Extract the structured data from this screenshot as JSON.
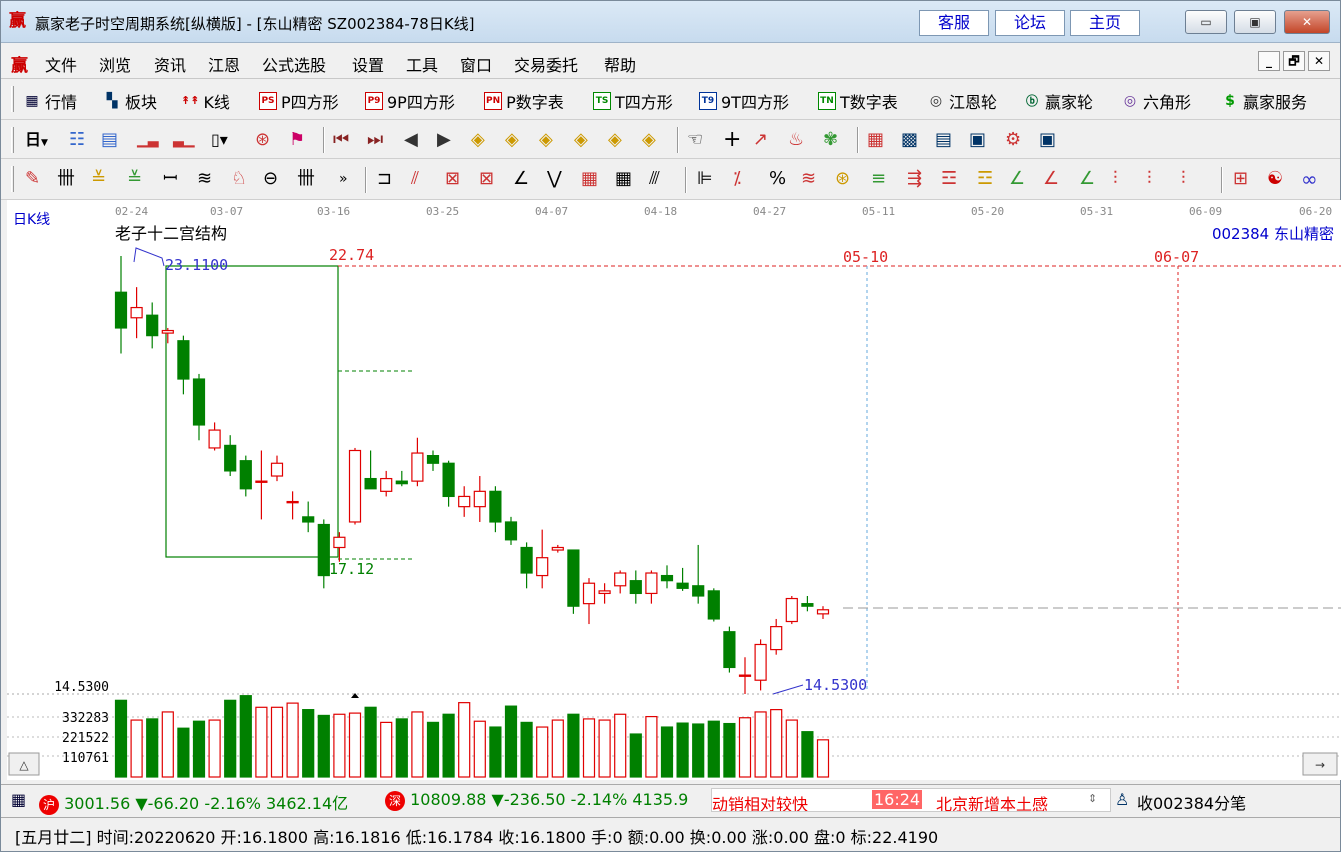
{
  "titlebar": {
    "app_icon": "赢",
    "title": "赢家老子时空周期系统[纵横版] - [东山精密  SZ002384-78日K线]",
    "links": [
      "客服",
      "论坛",
      "主页"
    ],
    "window_buttons": [
      "minimize",
      "maximize",
      "close"
    ]
  },
  "menubar": {
    "logo": "赢",
    "items": [
      "文件",
      "浏览",
      "资讯",
      "江恩",
      "公式选股",
      "设置",
      "工具",
      "窗口",
      "交易委托",
      "帮助"
    ],
    "mdi_buttons": [
      "_",
      "🗗",
      "✕"
    ]
  },
  "toolbar1": {
    "items": [
      {
        "icon": "table-icon",
        "label": "行情"
      },
      {
        "icon": "blocks-icon",
        "label": "板块"
      },
      {
        "icon": "kline-icon",
        "label": "K线"
      },
      {
        "icon": "PS",
        "label": "P四方形"
      },
      {
        "icon": "P9",
        "label": "9P四方形"
      },
      {
        "icon": "PN",
        "label": "P数字表"
      },
      {
        "icon": "TS",
        "label": "T四方形"
      },
      {
        "icon": "T9",
        "label": "9T四方形"
      },
      {
        "icon": "TN",
        "label": "T数字表"
      },
      {
        "icon": "wheel-icon",
        "label": "江恩轮"
      },
      {
        "icon": "big-wheel-icon",
        "label": "赢家轮"
      },
      {
        "icon": "hexagon-icon",
        "label": "六角形"
      },
      {
        "icon": "dollar-icon",
        "label": "赢家服务"
      }
    ]
  },
  "toolbar2": {
    "period": "日"
  },
  "chart": {
    "period_label": "日K线",
    "indicator_title": "老子十二宫结构",
    "stock_code_name": "002384  东山精密",
    "date_ticks": [
      "02-24",
      "03-07",
      "03-16",
      "03-25",
      "04-07",
      "04-18",
      "04-27",
      "05-11",
      "05-20",
      "05-31",
      "06-09",
      "06-20"
    ],
    "labels": {
      "high": "23.1100",
      "box_top": "22.74",
      "box_bottom": "17.12",
      "low": "14.5300",
      "date_a": "05-10",
      "date_b": "06-07"
    },
    "price_axis_low": "14.5300",
    "volume_axis": [
      "332283",
      "221522",
      "110761"
    ],
    "colors": {
      "up": "#e00000",
      "down": "#008000",
      "box": "#008000",
      "label_blue": "#3333cc",
      "label_red": "#dd2222"
    },
    "candles": [
      {
        "o": 22.4,
        "h": 23.11,
        "l": 21.2,
        "c": 21.7
      },
      {
        "o": 21.9,
        "h": 22.5,
        "l": 21.5,
        "c": 22.1
      },
      {
        "o": 21.95,
        "h": 22.2,
        "l": 21.3,
        "c": 21.55
      },
      {
        "o": 21.6,
        "h": 21.7,
        "l": 21.4,
        "c": 21.65
      },
      {
        "o": 21.45,
        "h": 21.55,
        "l": 20.4,
        "c": 20.7
      },
      {
        "o": 20.7,
        "h": 20.8,
        "l": 19.5,
        "c": 19.8
      },
      {
        "o": 19.35,
        "h": 19.85,
        "l": 19.3,
        "c": 19.7
      },
      {
        "o": 19.4,
        "h": 19.6,
        "l": 18.8,
        "c": 18.9
      },
      {
        "o": 19.1,
        "h": 19.2,
        "l": 18.4,
        "c": 18.55
      },
      {
        "o": 18.7,
        "h": 19.3,
        "l": 17.95,
        "c": 18.7
      },
      {
        "o": 18.8,
        "h": 19.2,
        "l": 18.7,
        "c": 19.05
      },
      {
        "o": 18.3,
        "h": 18.5,
        "l": 17.95,
        "c": 18.3
      },
      {
        "o": 18.0,
        "h": 18.3,
        "l": 17.7,
        "c": 17.9
      },
      {
        "o": 17.85,
        "h": 17.95,
        "l": 16.6,
        "c": 16.85
      },
      {
        "o": 17.4,
        "h": 17.7,
        "l": 17.12,
        "c": 17.6
      },
      {
        "o": 17.9,
        "h": 19.35,
        "l": 17.85,
        "c": 19.3
      },
      {
        "o": 18.75,
        "h": 19.3,
        "l": 18.6,
        "c": 18.55
      },
      {
        "o": 18.5,
        "h": 18.9,
        "l": 18.4,
        "c": 18.75
      },
      {
        "o": 18.7,
        "h": 18.9,
        "l": 18.6,
        "c": 18.65
      },
      {
        "o": 18.7,
        "h": 19.55,
        "l": 18.6,
        "c": 19.25
      },
      {
        "o": 19.2,
        "h": 19.3,
        "l": 18.9,
        "c": 19.05
      },
      {
        "o": 19.05,
        "h": 19.1,
        "l": 18.2,
        "c": 18.4
      },
      {
        "o": 18.2,
        "h": 18.6,
        "l": 18.0,
        "c": 18.4
      },
      {
        "o": 18.2,
        "h": 18.8,
        "l": 17.9,
        "c": 18.5
      },
      {
        "o": 18.5,
        "h": 18.6,
        "l": 17.7,
        "c": 17.9
      },
      {
        "o": 17.9,
        "h": 18.0,
        "l": 17.45,
        "c": 17.55
      },
      {
        "o": 17.4,
        "h": 17.5,
        "l": 16.6,
        "c": 16.9
      },
      {
        "o": 16.85,
        "h": 17.75,
        "l": 16.6,
        "c": 17.2
      },
      {
        "o": 17.35,
        "h": 17.45,
        "l": 17.3,
        "c": 17.4
      },
      {
        "o": 17.35,
        "h": 17.35,
        "l": 16.1,
        "c": 16.25
      },
      {
        "o": 16.3,
        "h": 16.8,
        "l": 15.9,
        "c": 16.7
      },
      {
        "o": 16.5,
        "h": 16.7,
        "l": 16.3,
        "c": 16.55
      },
      {
        "o": 16.65,
        "h": 16.95,
        "l": 16.5,
        "c": 16.9
      },
      {
        "o": 16.75,
        "h": 16.95,
        "l": 16.3,
        "c": 16.5
      },
      {
        "o": 16.5,
        "h": 16.95,
        "l": 16.3,
        "c": 16.9
      },
      {
        "o": 16.85,
        "h": 17.05,
        "l": 16.6,
        "c": 16.75
      },
      {
        "o": 16.7,
        "h": 17.0,
        "l": 16.55,
        "c": 16.6
      },
      {
        "o": 16.65,
        "h": 17.45,
        "l": 16.3,
        "c": 16.45
      },
      {
        "o": 16.55,
        "h": 16.6,
        "l": 15.95,
        "c": 16.0
      },
      {
        "o": 15.75,
        "h": 15.85,
        "l": 14.95,
        "c": 15.05
      },
      {
        "o": 14.9,
        "h": 15.25,
        "l": 14.53,
        "c": 14.9
      },
      {
        "o": 14.8,
        "h": 15.6,
        "l": 14.6,
        "c": 15.5
      },
      {
        "o": 15.4,
        "h": 16.0,
        "l": 15.3,
        "c": 15.85
      },
      {
        "o": 15.95,
        "h": 16.45,
        "l": 15.9,
        "c": 16.4
      },
      {
        "o": 16.3,
        "h": 16.45,
        "l": 16.15,
        "c": 16.25
      },
      {
        "o": 16.1,
        "h": 16.25,
        "l": 16.0,
        "c": 16.18
      }
    ],
    "volumes": [
      330000,
      245000,
      250000,
      280000,
      210000,
      240000,
      245000,
      330000,
      350000,
      300000,
      300000,
      318000,
      290000,
      265000,
      270000,
      275000,
      300000,
      235000,
      250000,
      280000,
      235000,
      270000,
      320000,
      240000,
      215000,
      305000,
      235000,
      215000,
      245000,
      270000,
      250000,
      245000,
      270000,
      185000,
      260000,
      215000,
      232000,
      228000,
      240000,
      230000,
      255000,
      280000,
      290000,
      245000,
      195000,
      160000
    ],
    "last_close": 16.18
  },
  "statusbar": {
    "sh_badge": "沪",
    "sh_text": "3001.56 ▼-66.20 -2.16% 3462.14亿",
    "sz_badge": "深",
    "sz_text": "10809.88 ▼-236.50 -2.14% 4135.9",
    "ticker_text": "动销相对较快",
    "ticker_time": "16:24",
    "ticker_news": "北京新增本土感",
    "right_text": "收002384分笔"
  },
  "infobar": {
    "text": "[五月廿二] 时间:20220620 开:16.1800 高:16.1816 低:16.1784 收:16.1800 手:0 额:0.00 换:0.00 涨:0.00 盘:0 标:22.4190"
  }
}
